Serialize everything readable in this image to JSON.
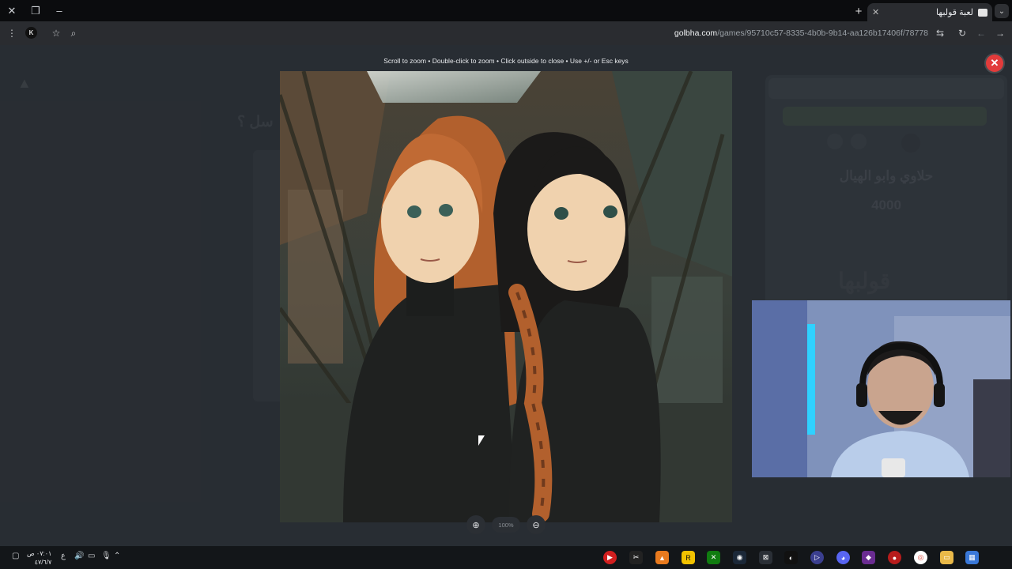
{
  "browser": {
    "tab_title": "لعبة قولبها",
    "url_domain": "golbha.com",
    "url_path": "/games/95710c57-8335-4b0b-9b14-aa126b17406f/78778"
  },
  "viewer": {
    "hint": "Scroll to zoom • Double-click to zoom • Click outside to close • Use +/- or Esc keys",
    "zoom_label": "100%"
  },
  "background": {
    "question_fragment": "سل ؟",
    "player_name": "حلاوي وابو الهيال",
    "score": "4000",
    "logo_text": "قولبها"
  },
  "taskbar": {
    "time": "٠٧:٠١ ص",
    "date": "٤٧/٦/٧"
  },
  "icons": {
    "close": "close-icon",
    "restore": "restore-icon",
    "minimize": "minimize-icon",
    "new_tab": "plus-icon",
    "menu": "kebab-menu-icon",
    "bookmark": "star-icon",
    "search": "search-icon",
    "reload": "reload-icon",
    "back": "back-arrow-icon",
    "forward": "forward-arrow-icon"
  },
  "colors": {
    "close_button": "#e23b3b",
    "overlay": "#14181c"
  }
}
